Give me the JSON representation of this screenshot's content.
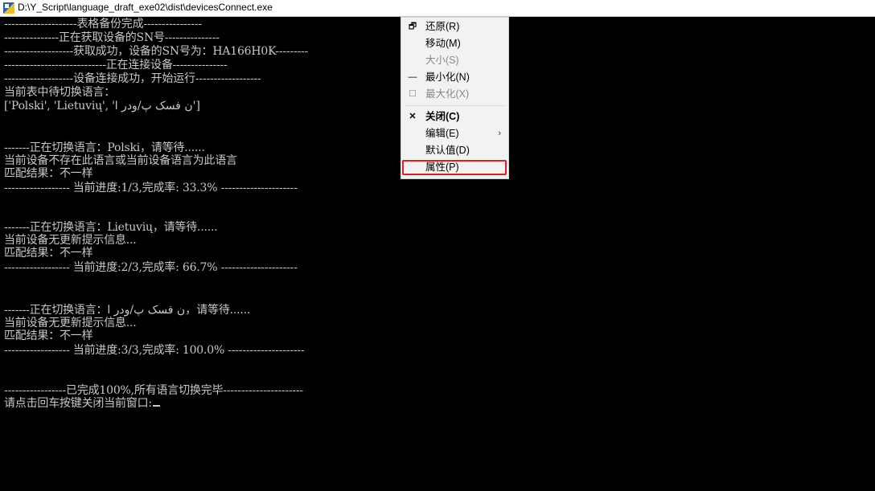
{
  "window": {
    "title": "D:\\Y_Script\\language_draft_exe02\\dist\\devicesConnect.exe",
    "icon": "console-app-icon"
  },
  "console": {
    "lines": [
      "--------------------表格备份完成----------------",
      "---------------正在获取设备的SN号---------------",
      "-------------------获取成功，设备的SN号为：HA166H0K---------",
      "----------------------------正在连接设备---------------",
      "-------------------设备连接成功，开始运行------------------",
      "当前表中待切换语言：",
      "['Polski', 'Lietuvių', 'ن فسک پ/ودر ا']",
      "",
      "",
      "-------正在切换语言：Polski，请等待......",
      "当前设备不存在此语言或当前设备语言为此语言",
      "匹配结果：不一样",
      "------------------ 当前进度:1/3,完成率: 33.3% ---------------------",
      "",
      "",
      "-------正在切换语言：Lietuvių，请等待......",
      "当前设备无更新提示信息...",
      "匹配结果：不一样",
      "------------------ 当前进度:2/3,完成率: 66.7% ---------------------",
      "",
      "",
      "-------正在切换语言：ن فسک پ/ودر ا，请等待......",
      "当前设备无更新提示信息...",
      "匹配结果：不一样",
      "------------------ 当前进度:3/3,完成率: 100.0% ---------------------",
      "",
      "",
      "-----------------已完成100%,所有语言切换完毕----------------------",
      "请点击回车按键关闭当前窗口:"
    ]
  },
  "context_menu": {
    "items": [
      {
        "icon": "restore-icon",
        "glyph": "🗗",
        "label": "还原(R)",
        "disabled": false,
        "bold": false
      },
      {
        "icon": "",
        "glyph": "",
        "label": "移动(M)",
        "disabled": false,
        "bold": false
      },
      {
        "icon": "",
        "glyph": "",
        "label": "大小(S)",
        "disabled": true,
        "bold": false
      },
      {
        "icon": "minimize-icon",
        "glyph": "—",
        "label": "最小化(N)",
        "disabled": false,
        "bold": false
      },
      {
        "icon": "maximize-icon",
        "glyph": "☐",
        "label": "最大化(X)",
        "disabled": true,
        "bold": false
      },
      {
        "icon": "close-icon",
        "glyph": "✕",
        "label": "关闭(C)",
        "disabled": false,
        "bold": true
      },
      {
        "icon": "",
        "glyph": "",
        "label": "编辑(E)",
        "disabled": false,
        "bold": false,
        "submenu": true
      },
      {
        "icon": "",
        "glyph": "",
        "label": "默认值(D)",
        "disabled": false,
        "bold": false
      },
      {
        "icon": "",
        "glyph": "",
        "label": "属性(P)",
        "disabled": false,
        "bold": false,
        "highlighted": true
      }
    ],
    "submenu_arrow": "›"
  },
  "colors": {
    "console_bg": "#000000",
    "console_text": "#c8c8c8",
    "menu_bg": "#f2f2f2",
    "highlight_border": "#e02020"
  }
}
